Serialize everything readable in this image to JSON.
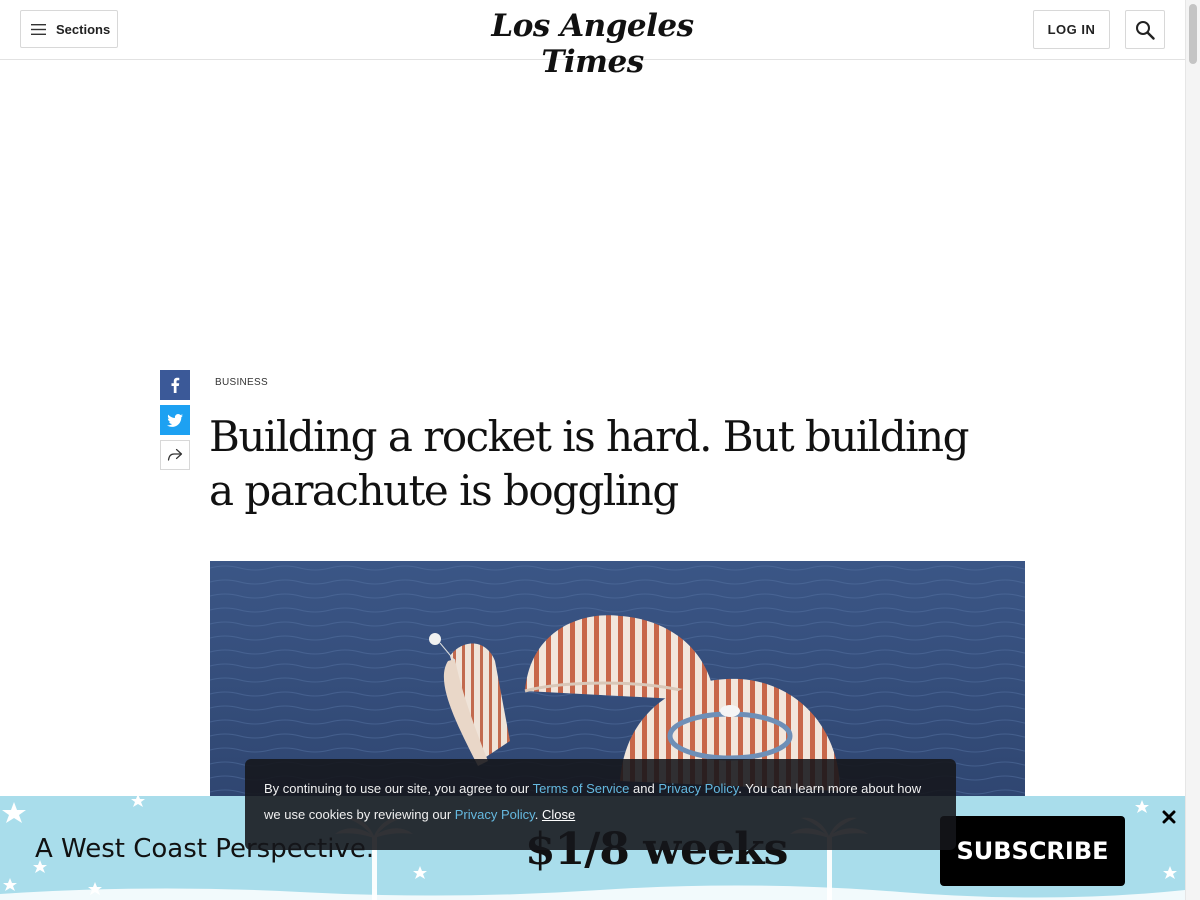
{
  "header": {
    "sections_label": "Sections",
    "logo_text": "Los Angeles Times",
    "login_label": "LOG IN"
  },
  "article": {
    "section": "BUSINESS",
    "headline": "Building a rocket is hard. But building a parachute is boggling"
  },
  "share": {
    "icons": [
      "facebook-icon",
      "twitter-icon",
      "share-arrow-icon"
    ]
  },
  "cookie_notice": {
    "text_1": "By continuing to use our site, you agree to our ",
    "terms_link": "Terms of Service",
    "text_2": " and ",
    "privacy_link_1": "Privacy Policy",
    "text_3": ". You can learn more about how we use cookies by reviewing our ",
    "privacy_link_2": "Privacy Policy",
    "text_4": ". ",
    "close_link": "Close"
  },
  "subscribe_banner": {
    "tagline": "A West Coast Perspective.",
    "price": "$1/8 weeks",
    "button_label": "SUBSCRIBE"
  },
  "colors": {
    "facebook": "#3b5998",
    "twitter": "#1da1f2",
    "banner_bg": "#a9ddeb",
    "link": "#65b9e0"
  }
}
